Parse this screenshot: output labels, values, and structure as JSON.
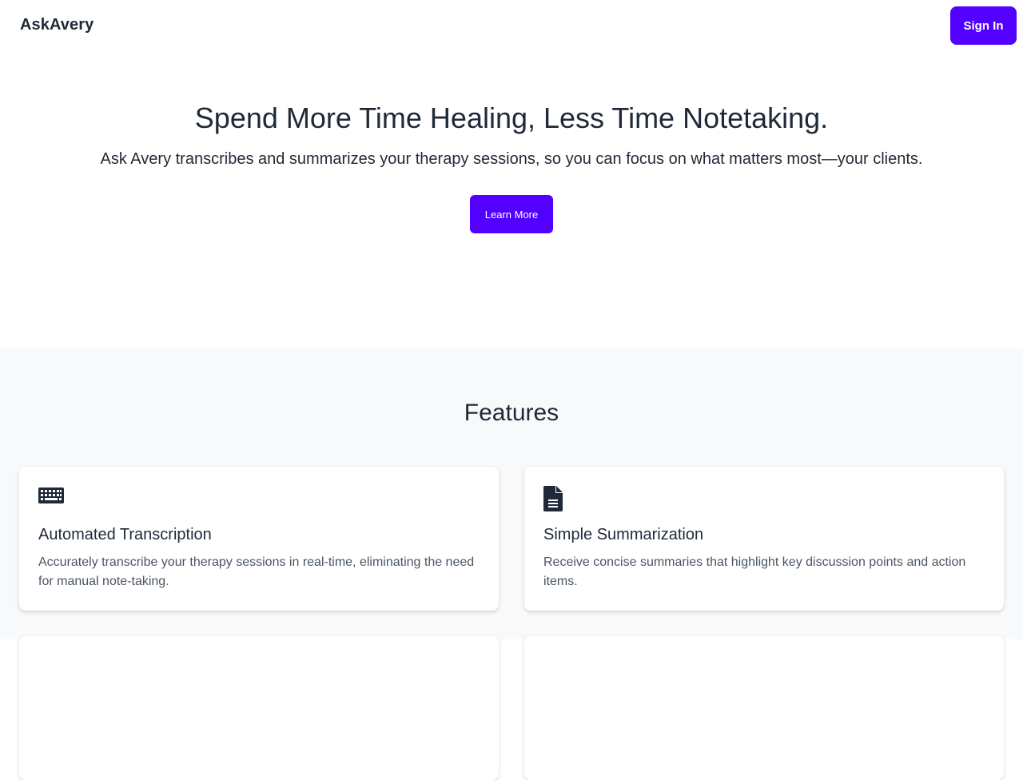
{
  "header": {
    "brand": "AskAvery",
    "sign_in_label": "Sign In"
  },
  "hero": {
    "title": "Spend More Time Healing, Less Time Notetaking.",
    "subtitle": "Ask Avery transcribes and summarizes your therapy sessions, so you can focus on what matters most—your clients.",
    "cta_label": "Learn More"
  },
  "features": {
    "heading": "Features",
    "items": [
      {
        "icon": "keyboard-icon",
        "title": "Automated Transcription",
        "description": "Accurately transcribe your therapy sessions in real-time, eliminating the need for manual note-taking."
      },
      {
        "icon": "document-icon",
        "title": "Simple Summarization",
        "description": "Receive concise summaries that highlight key discussion points and action items."
      }
    ]
  },
  "colors": {
    "accent": "#5200ff",
    "text": "#1f2937",
    "muted_text": "#4b5563",
    "features_bg": "#f8f9fb"
  }
}
